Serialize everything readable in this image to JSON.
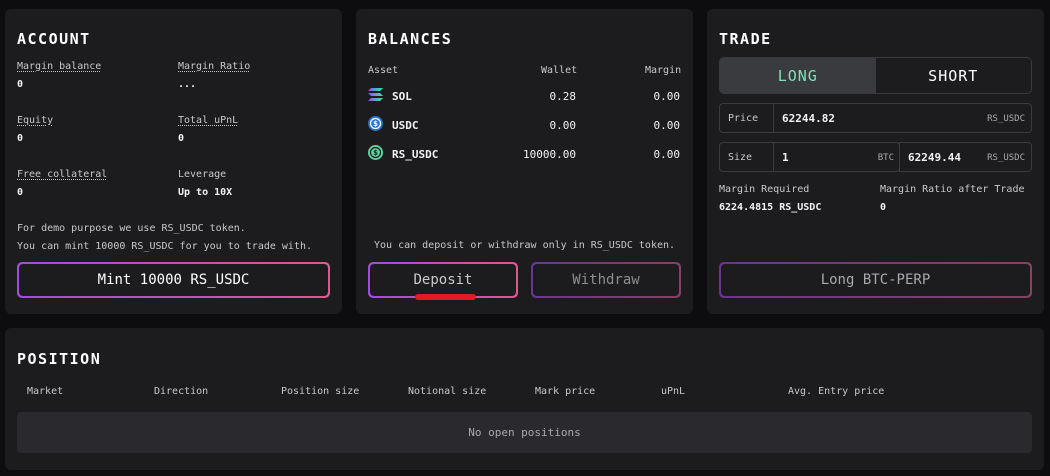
{
  "account": {
    "title": "ACCOUNT",
    "margin_balance_label": "Margin balance",
    "margin_balance_value": "0",
    "margin_ratio_label": "Margin Ratio",
    "margin_ratio_value": "...",
    "equity_label": "Equity",
    "equity_value": "0",
    "total_upnl_label": "Total uPnL",
    "total_upnl_value": "0",
    "free_collateral_label": "Free collateral",
    "free_collateral_value": "0",
    "leverage_label": "Leverage",
    "leverage_value": "Up to 10X",
    "note_line1": "For demo purpose we use RS_USDC token.",
    "note_line2": "You can mint 10000 RS_USDC for you to trade with.",
    "mint_button": "Mint 10000 RS_USDC"
  },
  "balances": {
    "title": "BALANCES",
    "headers": {
      "asset": "Asset",
      "wallet": "Wallet",
      "margin": "Margin"
    },
    "rows": [
      {
        "name": "SOL",
        "wallet": "0.28",
        "margin": "0.00",
        "icon": "solana-icon"
      },
      {
        "name": "USDC",
        "wallet": "0.00",
        "margin": "0.00",
        "icon": "usdc-icon"
      },
      {
        "name": "RS_USDC",
        "wallet": "10000.00",
        "margin": "0.00",
        "icon": "rs-usdc-icon"
      }
    ],
    "note": "You can deposit or withdraw only in RS_USDC token.",
    "deposit_button": "Deposit",
    "withdraw_button": "Withdraw"
  },
  "trade": {
    "title": "TRADE",
    "long_label": "LONG",
    "short_label": "SHORT",
    "price_label": "Price",
    "price_value": "62244.82",
    "price_unit": "RS_USDC",
    "size_label": "Size",
    "size_value": "1",
    "size_unit": "BTC",
    "notional_value": "62249.44",
    "notional_unit": "RS_USDC",
    "margin_required_label": "Margin Required",
    "margin_required_value": "6224.4815 RS_USDC",
    "margin_ratio_after_label": "Margin Ratio after Trade",
    "margin_ratio_after_value": "0",
    "submit_button": "Long BTC-PERP"
  },
  "position": {
    "title": "POSITION",
    "columns": [
      "Market",
      "Direction",
      "Position size",
      "Notional size",
      "Mark price",
      "uPnL",
      "Avg. Entry price"
    ],
    "empty_text": "No open positions"
  },
  "colors": {
    "panel": "#1c1c1f",
    "long_accent": "#7de3b8",
    "button_gradient_start": "#a24be0",
    "button_gradient_end": "#e0578e",
    "highlight": "#e01b24"
  }
}
